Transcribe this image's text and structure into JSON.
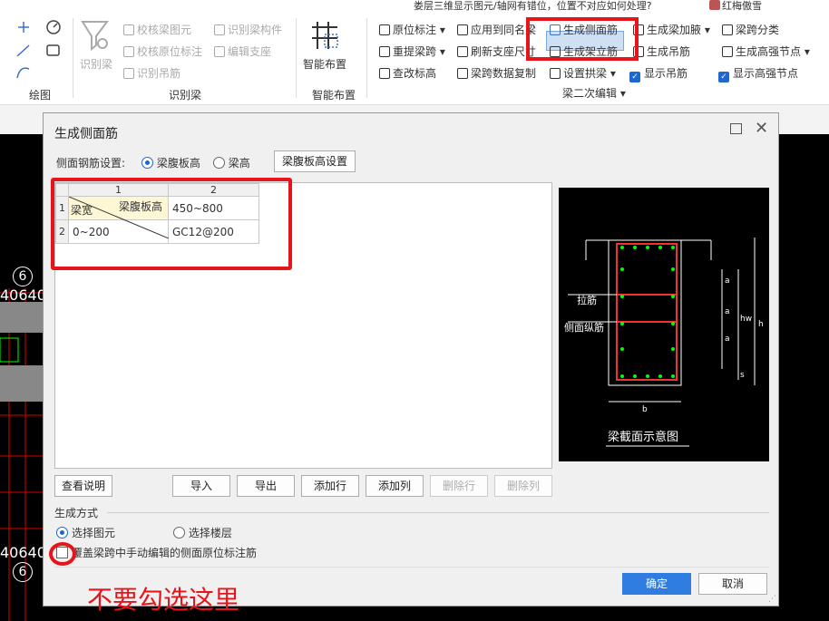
{
  "topbar": {
    "notice": "娄层三维显示图元/轴网有错位，位置不对应如何处理?",
    "user": "红梅傲雪"
  },
  "ribbon": {
    "draw_group": "绘图",
    "identify_group": "识别梁",
    "identify_beam": "识别梁",
    "check_beam_elem": "校核梁图元",
    "check_orig_mark": "校核原位标注",
    "identify_hanger": "识别吊筋",
    "identify_beam_member": "识别梁构件",
    "edit_support": "编辑支座",
    "smart_layout": "智能布置",
    "smart_group": "智能布置",
    "orig_mark": "原位标注",
    "apply_same_name": "应用到同名梁",
    "gen_side_bar": "生成侧面筋",
    "gen_haunch": "生成梁加腋",
    "span_classify": "梁跨分类",
    "re_extract_span": "重提梁跨",
    "refresh_support": "刷新支座尺寸",
    "gen_stirrup": "生成架立筋",
    "gen_hanger": "生成吊筋",
    "gen_high_node": "生成高强节点",
    "check_mark": "查改标高",
    "span_copy": "梁跨数据复制",
    "set_arch": "设置拱梁",
    "show_hanger": "显示吊筋",
    "show_high_node": "显示高强节点",
    "secondary_group": "梁二次编辑"
  },
  "cad": {
    "labels": [
      "6",
      "6"
    ],
    "nums": [
      "40640",
      "40640"
    ]
  },
  "dialog": {
    "title": "生成侧面筋",
    "setting_label": "侧面钢筋设置:",
    "opt_web_height": "梁腹板高",
    "opt_beam_height": "梁高",
    "web_height_btn": "梁腹板高设置",
    "table": {
      "col_headers": [
        "1",
        "2"
      ],
      "diag_top": "梁腹板高",
      "diag_bottom": "梁宽",
      "header_value": "450~800",
      "row2_label": "0~200",
      "row2_value": "GC12@200",
      "row_nums": [
        "1",
        "2"
      ]
    },
    "diagram": {
      "tie": "拉筋",
      "side_long": "侧面纵筋",
      "caption": "梁截面示意图",
      "dim_a": "a",
      "dim_hw": "hw",
      "dim_h": "h",
      "dim_s": "s",
      "dim_b": "b"
    },
    "buttons": {
      "view_desc": "查看说明",
      "import": "导入",
      "export": "导出",
      "add_row": "添加行",
      "add_col": "添加列",
      "del_row": "删除行",
      "del_col": "删除列",
      "ok": "确定",
      "cancel": "取消"
    },
    "gen_mode": "生成方式",
    "select_elem": "选择图元",
    "select_floor": "选择楼层",
    "overwrite": "覆盖梁跨中手动编辑的侧面原位标注筋"
  },
  "annotation": "不要勾选这里"
}
